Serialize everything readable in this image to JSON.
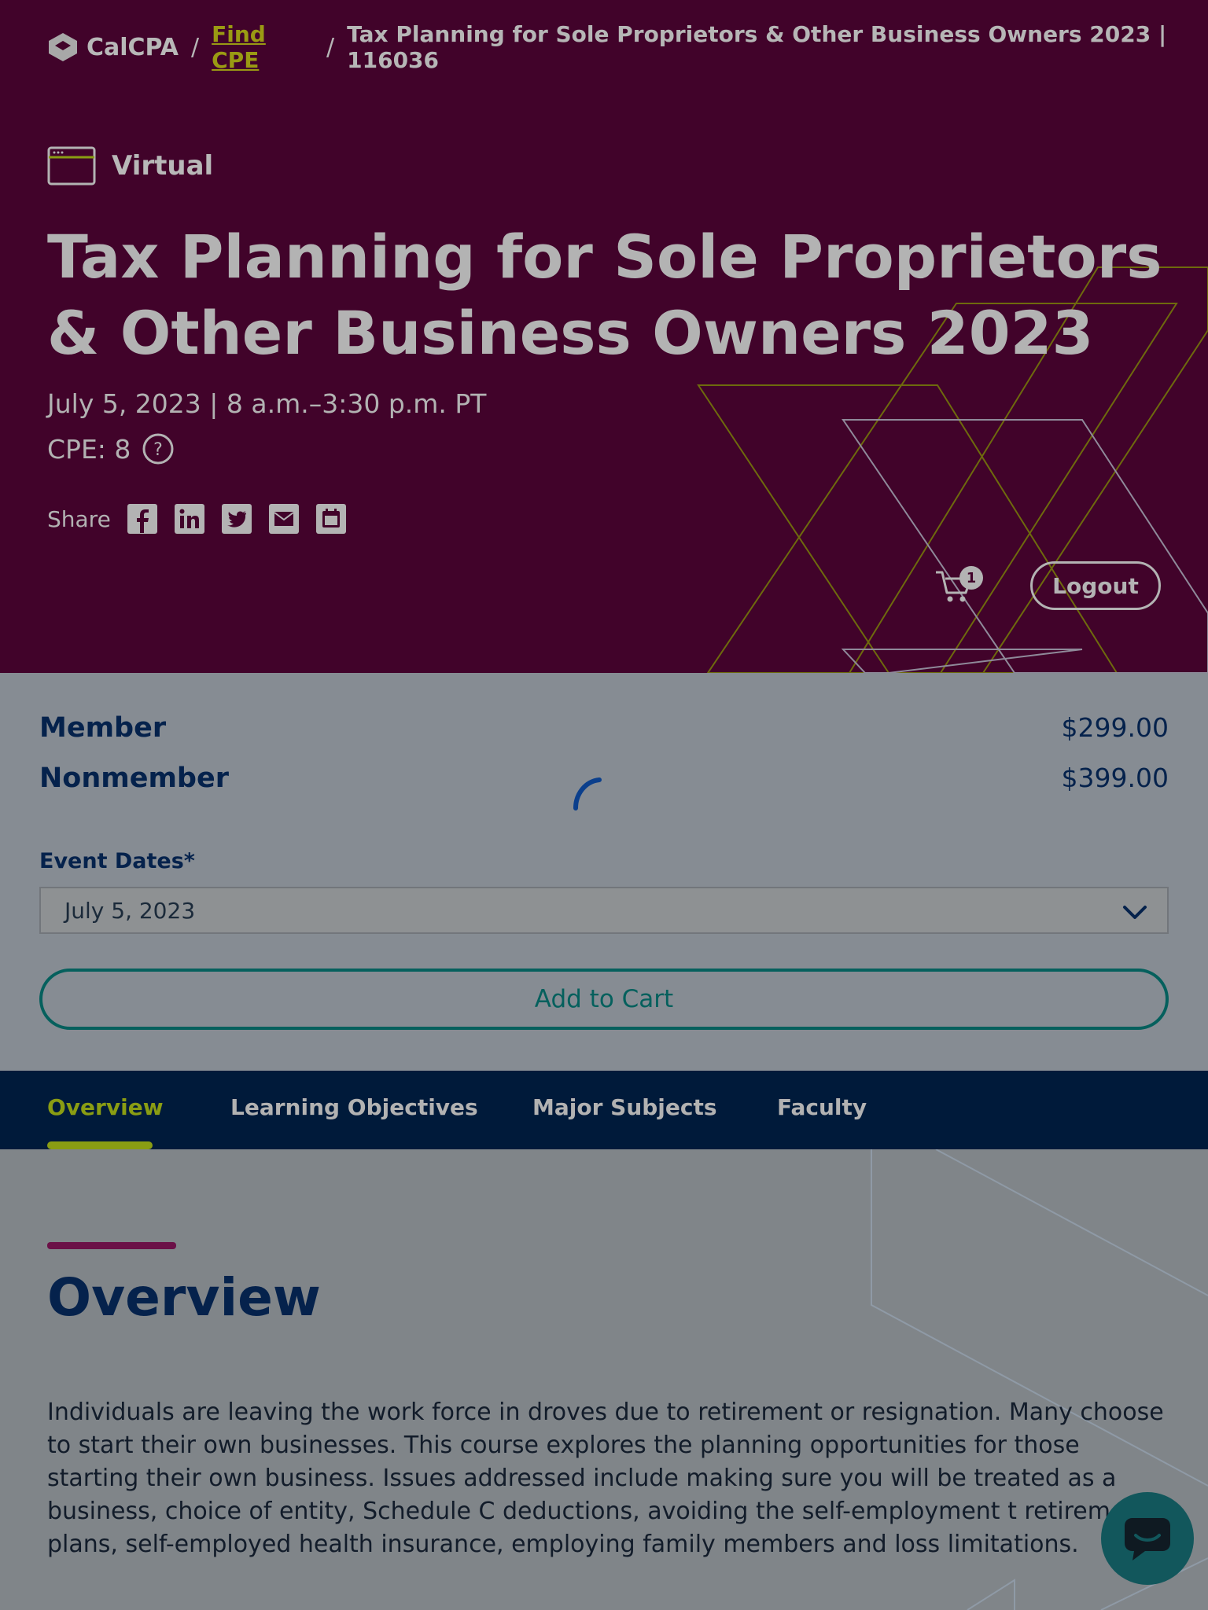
{
  "breadcrumb": {
    "logo_text": "CalCPA",
    "separator": "/",
    "find_cpe": "Find CPE",
    "current": "Tax Planning for Sole Proprietors & Other Business Owners 2023 | 116036"
  },
  "hero": {
    "format_label": "Virtual",
    "title": "Tax Planning for Sole Proprietors & Other Business Owners 2023",
    "date_time": "July 5, 2023 | 8 a.m.–3:30 p.m. PT",
    "cpe": "CPE: 8",
    "share_label": "Share",
    "share_icons": [
      "facebook-icon",
      "linkedin-icon",
      "twitter-icon",
      "email-icon",
      "calendar-icon"
    ],
    "cart_count": "1",
    "logout_label": "Logout"
  },
  "pricing": {
    "member_label": "Member",
    "member_price": "$299.00",
    "nonmember_label": "Nonmember",
    "nonmember_price": "$399.00"
  },
  "event_dates": {
    "label": "Event Dates*",
    "selected": "July 5, 2023"
  },
  "add_to_cart_label": "Add to Cart",
  "tabs": [
    {
      "label": "Overview",
      "active": true
    },
    {
      "label": "Learning Objectives",
      "active": false
    },
    {
      "label": "Major Subjects",
      "active": false
    },
    {
      "label": "Faculty",
      "active": false
    }
  ],
  "overview": {
    "heading": "Overview",
    "body": "Individuals are leaving the work force in droves due to retirement or resignation. Many choose to start their own businesses. This course explores the planning opportunities for those starting their own business. Issues addressed include making sure you will be treated as a business, choice of entity, Schedule C deductions, avoiding the self-employment t retirement plans, self-employed health insurance, employing family members and loss limitations."
  },
  "colors": {
    "hero_bg": "#41032a",
    "accent_green": "#8a9d13",
    "navy": "#05224c",
    "teal": "#05605d"
  }
}
